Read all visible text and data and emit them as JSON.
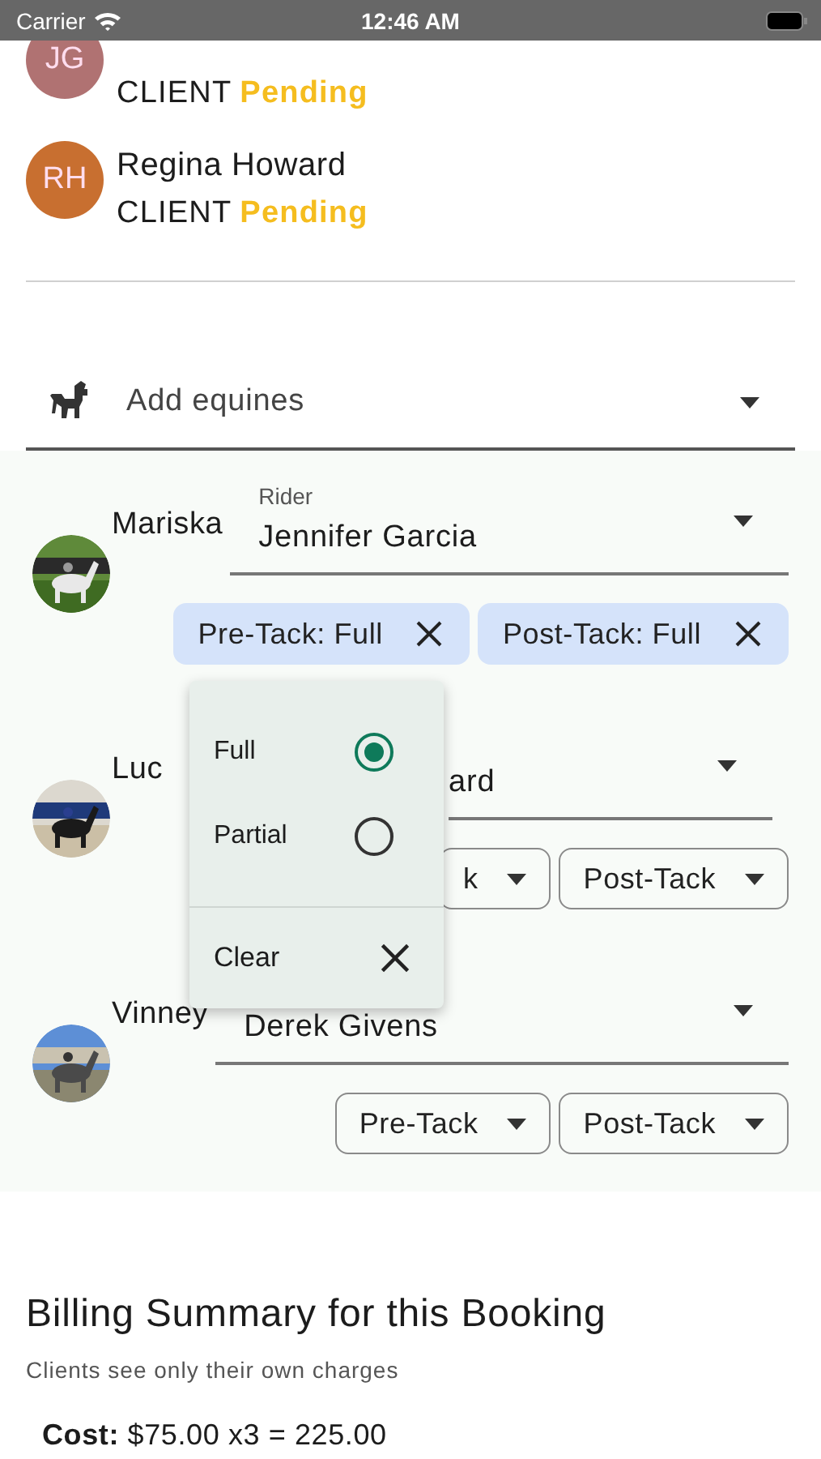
{
  "status_bar": {
    "carrier": "Carrier",
    "time": "12:46 AM"
  },
  "clients": [
    {
      "initials": "JG",
      "color": "#b07272",
      "role": "CLIENT",
      "status": "Pending"
    },
    {
      "initials": "RH",
      "name": "Regina Howard",
      "color": "#c86f30",
      "role": "CLIENT",
      "status": "Pending"
    }
  ],
  "equine_field": {
    "label": "Add equines"
  },
  "equines": [
    {
      "kind": "full",
      "name": "Mariska",
      "rider_label": "Rider",
      "rider": "Jennifer Garcia",
      "tack": [
        {
          "label": "Pre-Tack: Full",
          "selected": true
        },
        {
          "label": "Post-Tack: Full",
          "selected": true
        }
      ]
    },
    {
      "kind": "covered",
      "name": "Luc",
      "rider": "ard",
      "tack": [
        {
          "label": "k",
          "selected": false
        },
        {
          "label": "Post-Tack",
          "selected": false
        }
      ]
    },
    {
      "kind": "full",
      "name": "Vinney",
      "rider": "Derek Givens",
      "tack": [
        {
          "label": "Pre-Tack",
          "selected": false
        },
        {
          "label": "Post-Tack",
          "selected": false
        }
      ]
    }
  ],
  "menu": {
    "options": [
      {
        "label": "Full",
        "selected": true
      },
      {
        "label": "Partial",
        "selected": false
      }
    ],
    "clear": "Clear"
  },
  "billing": {
    "title": "Billing Summary for this Booking",
    "subtitle": "Clients see only their own charges",
    "cost": "**Cost:** $75.00 x3 = 225.00"
  }
}
